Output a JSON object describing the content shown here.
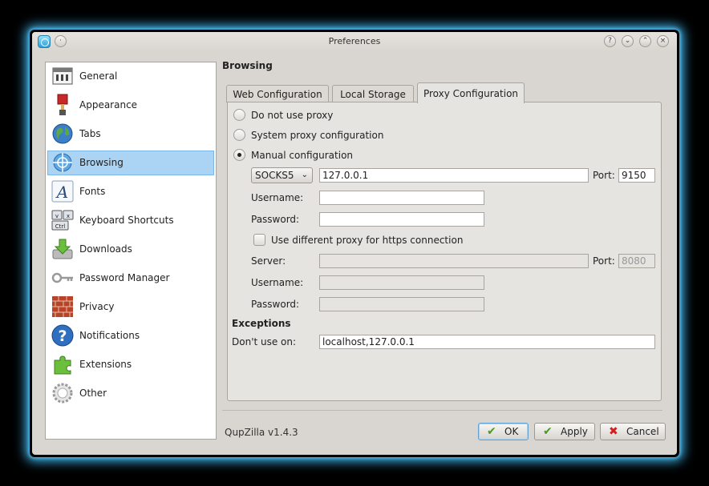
{
  "window": {
    "title": "Preferences"
  },
  "sidebar": {
    "items": [
      {
        "label": "General",
        "icon": "general-icon"
      },
      {
        "label": "Appearance",
        "icon": "paintbrush-icon"
      },
      {
        "label": "Tabs",
        "icon": "globe-icon"
      },
      {
        "label": "Browsing",
        "icon": "compass-icon",
        "selected": true
      },
      {
        "label": "Fonts",
        "icon": "font-icon"
      },
      {
        "label": "Keyboard Shortcuts",
        "icon": "keyboard-icon"
      },
      {
        "label": "Downloads",
        "icon": "download-icon"
      },
      {
        "label": "Password Manager",
        "icon": "key-icon"
      },
      {
        "label": "Privacy",
        "icon": "brick-wall-icon"
      },
      {
        "label": "Notifications",
        "icon": "question-icon"
      },
      {
        "label": "Extensions",
        "icon": "puzzle-icon"
      },
      {
        "label": "Other",
        "icon": "gear-icon"
      }
    ]
  },
  "section_title": "Browsing",
  "tabs": [
    {
      "label": "Web Configuration"
    },
    {
      "label": "Local Storage"
    },
    {
      "label": "Proxy Configuration",
      "active": true
    }
  ],
  "proxy": {
    "no_proxy": "Do not use proxy",
    "system_proxy": "System proxy configuration",
    "manual": "Manual configuration",
    "selected_mode": "Manual configuration",
    "type": "SOCKS5",
    "host": "127.0.0.1",
    "port_label": "Port:",
    "port": "9150",
    "username_label": "Username:",
    "username": "",
    "password_label": "Password:",
    "password": "",
    "https_checkbox": "Use different proxy for https connection",
    "https_checked": false,
    "server_label": "Server:",
    "https_server": "",
    "https_port_label": "Port:",
    "https_port": "8080",
    "https_username_label": "Username:",
    "https_username": "",
    "https_password_label": "Password:",
    "https_password": ""
  },
  "exceptions": {
    "heading": "Exceptions",
    "label": "Don't use on:",
    "value": "localhost,127.0.0.1"
  },
  "footer": {
    "version": "QupZilla v1.4.3",
    "ok": "OK",
    "apply": "Apply",
    "cancel": "Cancel"
  },
  "colors": {
    "selection": "#abd3f3",
    "glow": "#3fb6ee",
    "window_bg": "#d9d6d1"
  }
}
